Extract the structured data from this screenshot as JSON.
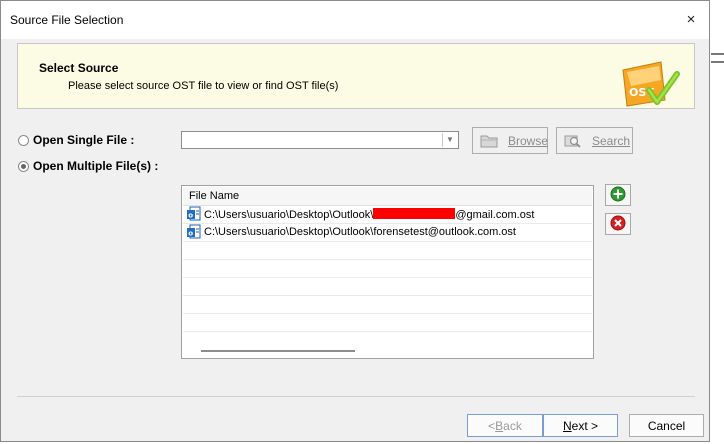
{
  "window": {
    "title": "Source File Selection",
    "close_symbol": "×"
  },
  "header": {
    "title": "Select Source",
    "subtitle": "Please select source OST file to view or find OST file(s)",
    "icon_text": "OST"
  },
  "options": {
    "single": {
      "label": "Open Single File :",
      "selected": false
    },
    "multiple": {
      "label": "Open Multiple File(s) :",
      "selected": true
    }
  },
  "single_file": {
    "combo_value": "",
    "browse_label": "Browse",
    "search_label": "Search",
    "browse_enabled": false,
    "search_enabled": false
  },
  "file_list": {
    "column_header": "File Name",
    "rows": [
      {
        "prefix": "C:\\Users\\usuario\\Desktop\\Outlook\\",
        "suffix": "@gmail.com.ost",
        "redacted": true
      },
      {
        "prefix": "C:\\Users\\usuario\\Desktop\\Outlook\\forensetest@outlook.com.ost",
        "suffix": "",
        "redacted": false
      }
    ]
  },
  "buttons": {
    "back_hotkey": "B",
    "back_rest": "ack",
    "back_prefix": "< ",
    "next_hotkey": "N",
    "next_rest": "ext >",
    "cancel": "Cancel",
    "back_enabled": false
  },
  "colors": {
    "header_bg": "#fcfbe4",
    "add_green": "#2e9b2e",
    "remove_red": "#d42020",
    "redaction": "#ff0000",
    "button_border": "#7a9cd3"
  },
  "icons": {
    "add": "plus-circle-icon",
    "remove": "x-circle-icon",
    "browse": "folder-icon",
    "search": "magnifier-icon",
    "file": "ost-file-icon"
  }
}
